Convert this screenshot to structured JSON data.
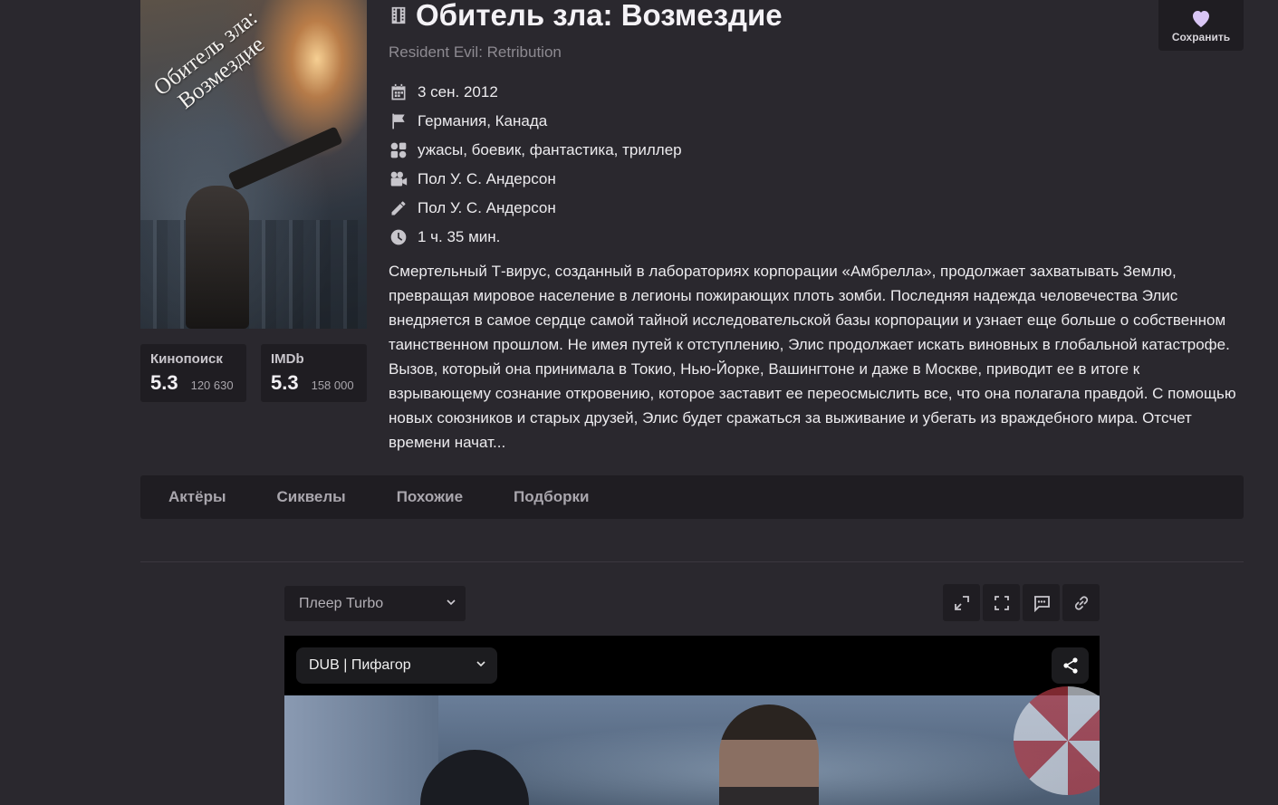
{
  "movie": {
    "title": "Обитель зла: Возмездие",
    "original_title": "Resident Evil: Retribution",
    "poster_title": "Обитель зла:\nВозмездие",
    "meta": [
      {
        "icon": "calendar-icon",
        "text": "3 сен. 2012"
      },
      {
        "icon": "flag-icon",
        "text": "Германия, Канада"
      },
      {
        "icon": "genres-icon",
        "text": "ужасы, боевик, фантастика, триллер"
      },
      {
        "icon": "camera-icon",
        "text": "Пол У. С. Андерсон"
      },
      {
        "icon": "pencil-icon",
        "text": "Пол У. С. Андерсон"
      },
      {
        "icon": "clock-icon",
        "text": "1 ч. 35 мин."
      }
    ],
    "description": "Смертельный Т-вирус, созданный в лабораториях корпорации «Амбрелла», продолжает захватывать Землю, превращая мировое население в легионы пожирающих плоть зомби. Последняя надежда человечества Элис внедряется в самое сердце самой тайной исследовательской базы корпорации и узнает еще больше о собственном таинственном прошлом. Не имея путей к отступлению, Элис продолжает искать виновных в глобальной катастрофе. Вызов, который она принимала в Токио, Нью-Йорке, Вашингтоне и даже в Москве, приводит ее в итоге к взрывающему сознание откровению, которое заставит ее переосмыслить все, что она полагала правдой. С помощью новых союзников и старых друзей, Элис будет сражаться за выживание и убегать из враждебного мира. Отсчет времени начат..."
  },
  "ratings": {
    "kinopoisk": {
      "name": "Кинопоиск",
      "score": "5.3",
      "votes": "120 630"
    },
    "imdb": {
      "name": "IMDb",
      "score": "5.3",
      "votes": "158 000"
    }
  },
  "save": {
    "label": "Сохранить"
  },
  "tabs": [
    {
      "label": "Актёры"
    },
    {
      "label": "Сиквелы"
    },
    {
      "label": "Похожие"
    },
    {
      "label": "Подборки"
    }
  ],
  "player": {
    "selected": "Плеер Turbo",
    "dub_selected": "DUB | Пифагор"
  },
  "colors": {
    "background": "#2a282e",
    "panel": "#1f1d22",
    "heart": "#d9c6f5"
  }
}
